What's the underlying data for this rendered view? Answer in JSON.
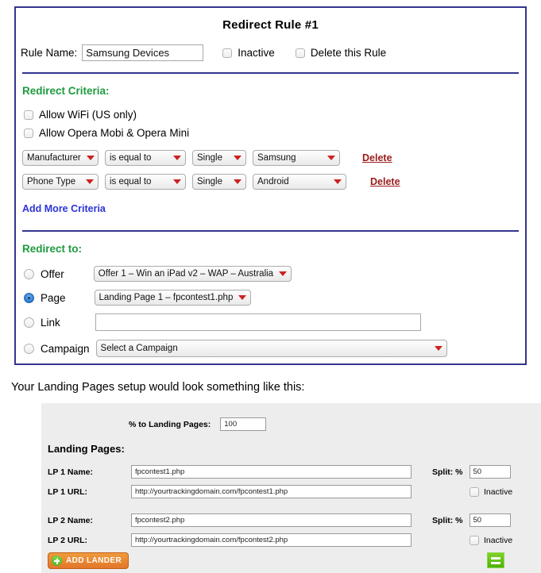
{
  "rule": {
    "title": "Redirect Rule #1",
    "rule_name_label": "Rule Name:",
    "rule_name_value": "Samsung Devices",
    "inactive_label": "Inactive",
    "delete_rule_label": "Delete this Rule",
    "criteria_heading": "Redirect Criteria:",
    "allow_wifi_label": "Allow WiFi (US only)",
    "allow_opera_label": "Allow Opera Mobi & Opera Mini",
    "criteria_rows": [
      {
        "field": "Manufacturer",
        "operator": "is equal to",
        "mode": "Single",
        "value": "Samsung",
        "delete_label": "Delete"
      },
      {
        "field": "Phone Type",
        "operator": "is equal to",
        "mode": "Single",
        "value": "Android",
        "delete_label": "Delete"
      }
    ],
    "add_more_label": "Add More Criteria",
    "redirect_heading": "Redirect to:",
    "redirect_options": [
      {
        "label": "Offer",
        "selected": false,
        "control": "dropdown",
        "value": "Offer 1 – Win an iPad v2 – WAP – Australia"
      },
      {
        "label": "Page",
        "selected": true,
        "control": "dropdown",
        "value": "Landing Page 1 – fpcontest1.php"
      },
      {
        "label": "Link",
        "selected": false,
        "control": "text",
        "value": ""
      },
      {
        "label": "Campaign",
        "selected": false,
        "control": "dropdown",
        "value": "Select a Campaign"
      }
    ]
  },
  "caption": "Your Landing Pages setup would look something like this:",
  "landing_pages": {
    "percent_label": "% to Landing Pages:",
    "percent_value": "100",
    "heading": "Landing Pages:",
    "split_label": "Split: %",
    "inactive_label": "Inactive",
    "rows": [
      {
        "name_label": "LP 1 Name:",
        "name_value": "fpcontest1.php",
        "url_label": "LP 1 URL:",
        "url_value": "http://yourtrackingdomain.com/fpcontest1.php",
        "split_value": "50"
      },
      {
        "name_label": "LP 2 Name:",
        "name_value": "fpcontest2.php",
        "url_label": "LP 2 URL:",
        "url_value": "http://yourtrackingdomain.com/fpcontest2.php",
        "split_value": "50"
      }
    ],
    "add_lander_label": "ADD LANDER",
    "list_icon": "list-icon"
  },
  "colors": {
    "panel_border": "#33348e",
    "heading_green": "#1d9b3e",
    "delete_red": "#9b1c1c",
    "link_blue": "#2b34d6",
    "arrow_red": "#cc2222",
    "lp_background": "#ededed",
    "add_lander_orange": "#e2762a",
    "list_button_green": "#4fb00c"
  }
}
